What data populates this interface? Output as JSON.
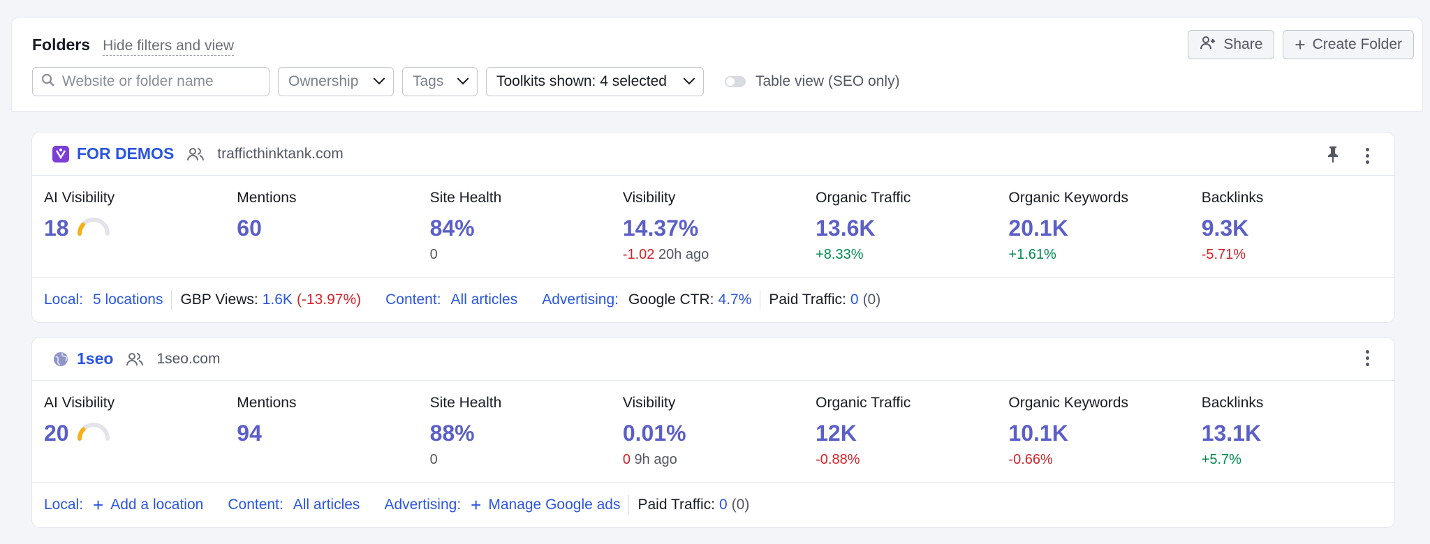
{
  "header": {
    "title": "Folders",
    "hide_link": "Hide filters and view",
    "share_label": "Share",
    "create_label": "Create Folder"
  },
  "filters": {
    "search_placeholder": "Website or folder name",
    "ownership": "Ownership",
    "tags": "Tags",
    "toolkits": "Toolkits shown: 4 selected",
    "table_view": "Table view (SEO only)"
  },
  "colors": {
    "link": "#2a55e0",
    "metric": "#5b5fc7",
    "negative": "#d1232a",
    "positive": "#008a4d",
    "gauge": "#f5b017"
  },
  "projects": [
    {
      "name": "FOR DEMOS",
      "domain": "trafficthinktank.com",
      "icon": "project-logo-icon",
      "pinned": true,
      "metrics": {
        "ai_visibility": {
          "label": "AI Visibility",
          "value": "18",
          "gauge_level": 0.18
        },
        "mentions": {
          "label": "Mentions",
          "value": "60"
        },
        "site_health": {
          "label": "Site Health",
          "value": "84%",
          "sub": "0"
        },
        "visibility": {
          "label": "Visibility",
          "value": "14.37%",
          "delta": "-1.02",
          "ago": "20h ago"
        },
        "organic_traffic": {
          "label": "Organic Traffic",
          "value": "13.6K",
          "delta": "+8.33%"
        },
        "organic_keywords": {
          "label": "Organic Keywords",
          "value": "20.1K",
          "delta": "+1.61%"
        },
        "backlinks": {
          "label": "Backlinks",
          "value": "9.3K",
          "delta": "-5.71%"
        }
      },
      "footer": {
        "local_label": "Local:",
        "local_value": "5 locations",
        "gbp_label": "GBP Views:",
        "gbp_value": "1.6K",
        "gbp_delta": "(-13.97%)",
        "content_label": "Content:",
        "content_value": "All articles",
        "advertising_label": "Advertising:",
        "ctr_label": "Google CTR:",
        "ctr_value": "4.7%",
        "paid_label": "Paid Traffic:",
        "paid_value": "0",
        "paid_delta": "(0)"
      }
    },
    {
      "name": "1seo",
      "domain": "1seo.com",
      "icon": "globe-icon",
      "pinned": false,
      "metrics": {
        "ai_visibility": {
          "label": "AI Visibility",
          "value": "20",
          "gauge_level": 0.2
        },
        "mentions": {
          "label": "Mentions",
          "value": "94"
        },
        "site_health": {
          "label": "Site Health",
          "value": "88%",
          "sub": "0"
        },
        "visibility": {
          "label": "Visibility",
          "value": "0.01%",
          "delta": "0",
          "ago": "9h ago"
        },
        "organic_traffic": {
          "label": "Organic Traffic",
          "value": "12K",
          "delta": "-0.88%"
        },
        "organic_keywords": {
          "label": "Organic Keywords",
          "value": "10.1K",
          "delta": "-0.66%"
        },
        "backlinks": {
          "label": "Backlinks",
          "value": "13.1K",
          "delta": "+5.7%"
        }
      },
      "footer": {
        "local_label": "Local:",
        "local_action": "Add a location",
        "content_label": "Content:",
        "content_value": "All articles",
        "advertising_label": "Advertising:",
        "ads_action": "Manage Google ads",
        "paid_label": "Paid Traffic:",
        "paid_value": "0",
        "paid_delta": "(0)"
      }
    }
  ]
}
